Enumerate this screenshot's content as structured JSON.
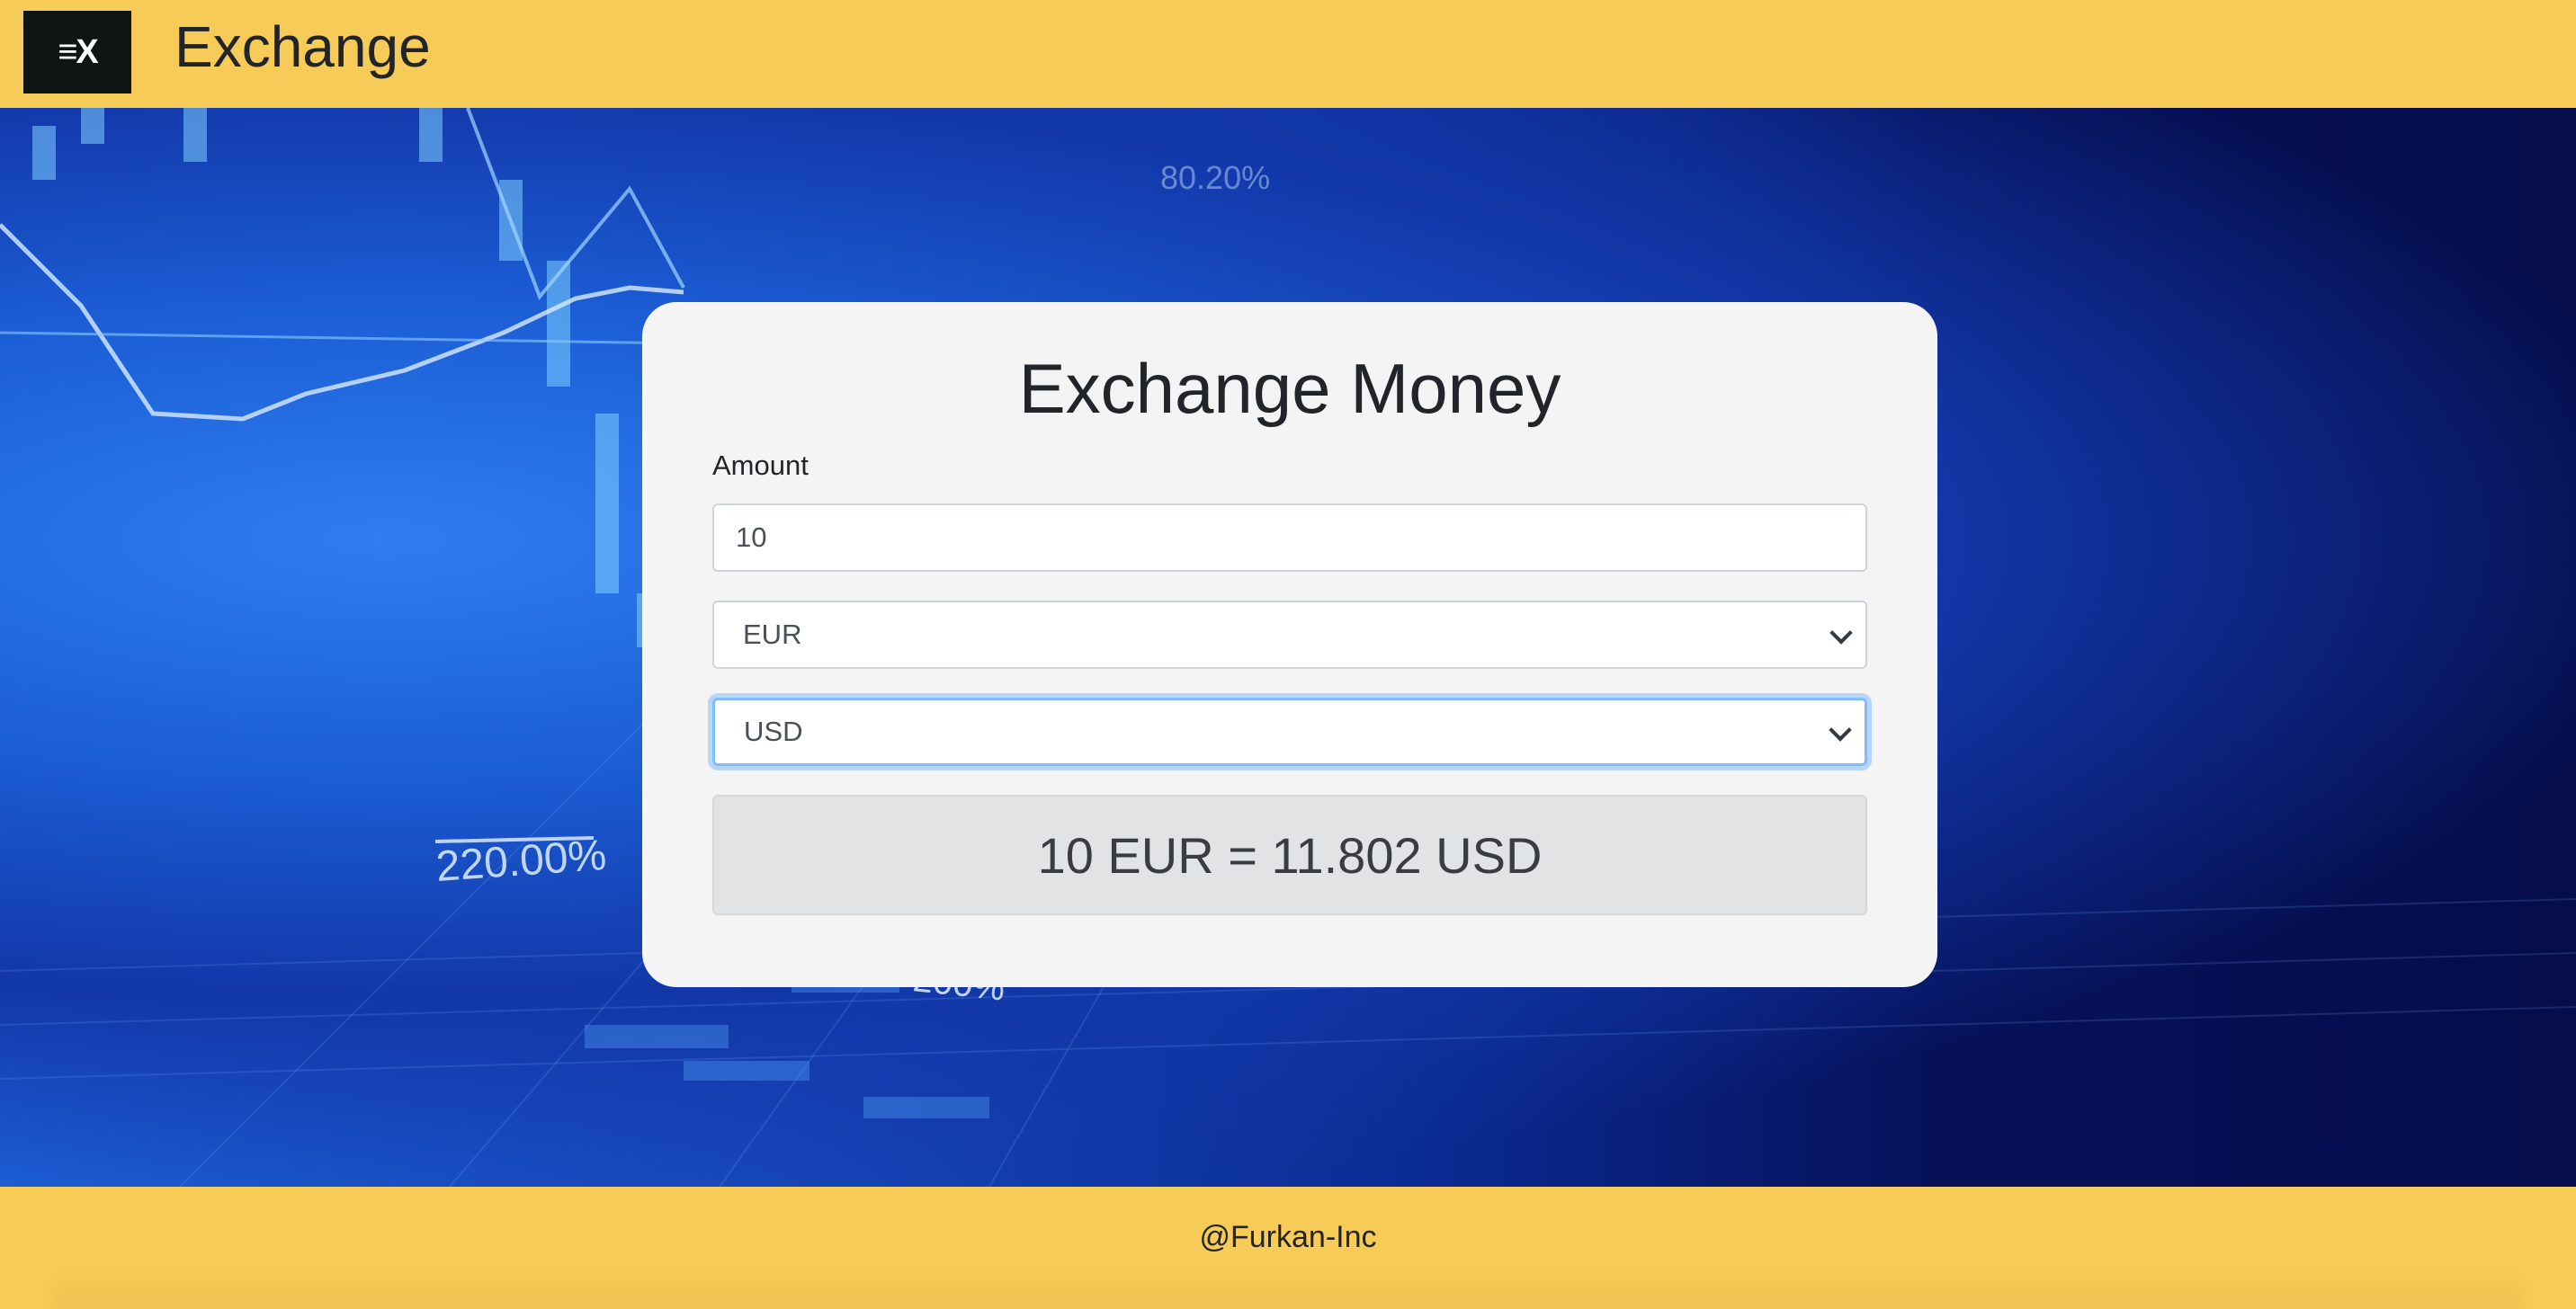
{
  "header": {
    "logo_text": "≡X",
    "brand": "Exchange"
  },
  "hero": {
    "background_labels": [
      "220.00%",
      "200%",
      "80.20%"
    ]
  },
  "card": {
    "title": "Exchange Money",
    "amount_label": "Amount",
    "amount_value": "10",
    "from_currency": "EUR",
    "to_currency": "USD",
    "result": "10 EUR = 11.802 USD"
  },
  "footer": {
    "text": "@Furkan-Inc"
  },
  "colors": {
    "accent_yellow": "#f7cb57",
    "hero_blue": "#1e63db",
    "hero_dark": "#06115a",
    "card_bg": "#f4f4f4",
    "result_bg": "#e2e3e5",
    "focus_border": "#80bdff"
  }
}
